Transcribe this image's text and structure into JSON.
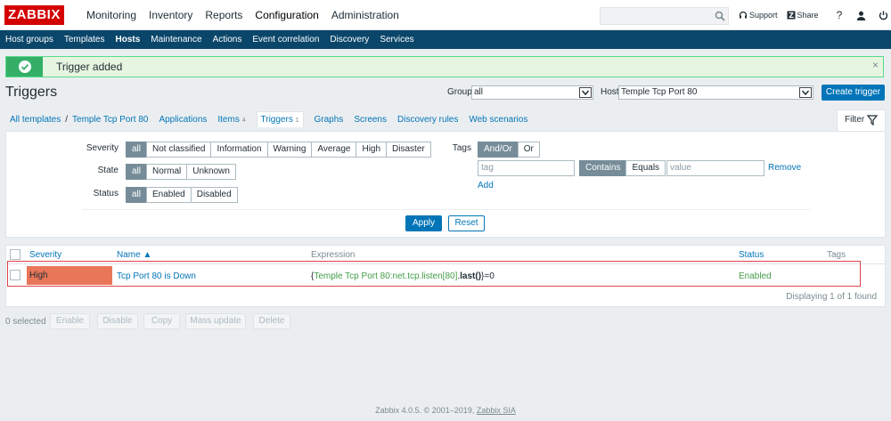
{
  "header": {
    "logo": "ZABBIX",
    "menu": [
      "Monitoring",
      "Inventory",
      "Reports",
      "Configuration",
      "Administration"
    ],
    "active_menu": "Configuration",
    "support": "Support",
    "share": "Share",
    "help": "?"
  },
  "submenu": [
    "Host groups",
    "Templates",
    "Hosts",
    "Maintenance",
    "Actions",
    "Event correlation",
    "Discovery",
    "Services"
  ],
  "message": {
    "text": "Trigger added",
    "close": "×"
  },
  "page": {
    "title": "Triggers",
    "group_label": "Group",
    "group_value": "all",
    "host_label": "Host",
    "host_value": "Temple Tcp Port 80",
    "create_button": "Create trigger"
  },
  "nav": {
    "all_templates": "All templates",
    "separator": "/",
    "template": "Temple Tcp Port 80",
    "applications": "Applications",
    "items": "Items",
    "items_count": "4",
    "triggers": "Triggers",
    "triggers_count": "1",
    "graphs": "Graphs",
    "screens": "Screens",
    "discovery": "Discovery rules",
    "web": "Web scenarios",
    "filter_tab": "Filter"
  },
  "filter": {
    "severity_label": "Severity",
    "severity": [
      "all",
      "Not classified",
      "Information",
      "Warning",
      "Average",
      "High",
      "Disaster"
    ],
    "state_label": "State",
    "state": [
      "all",
      "Normal",
      "Unknown"
    ],
    "status_label": "Status",
    "status": [
      "all",
      "Enabled",
      "Disabled"
    ],
    "tags_label": "Tags",
    "tags_mode": [
      "And/Or",
      "Or"
    ],
    "tag_placeholder": "tag",
    "operator": [
      "Contains",
      "Equals"
    ],
    "value_placeholder": "value",
    "remove": "Remove",
    "add": "Add",
    "apply": "Apply",
    "reset": "Reset"
  },
  "table": {
    "columns": {
      "severity": "Severity",
      "name": "Name ▲",
      "expression": "Expression",
      "status": "Status",
      "tags": "Tags"
    },
    "row": {
      "severity": "High",
      "name": "Tcp Port 80 is Down",
      "expr_open": "{",
      "expr_item": "Temple Tcp Port 80:net.tcp.listen[80]",
      "expr_dot": ".",
      "expr_func": "last()",
      "expr_close": "}=0",
      "status": "Enabled"
    },
    "footer": "Displaying 1 of 1 found"
  },
  "mass": {
    "selected": "0 selected",
    "buttons": [
      "Enable",
      "Disable",
      "Copy",
      "Mass update",
      "Delete"
    ]
  },
  "footer": {
    "text": "Zabbix 4.0.5. © 2001–2019,",
    "company": "Zabbix SIA"
  },
  "colors": {
    "brand": "#d40000",
    "nav": "#0a466a",
    "accent": "#0275b8",
    "high": "#e97659",
    "ok": "#34af67"
  }
}
